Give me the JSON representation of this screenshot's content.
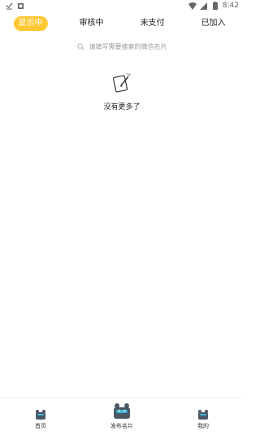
{
  "status_bar": {
    "time": "8:42",
    "icons": [
      "download-icon",
      "notification-icon",
      "wifi-icon",
      "signal-icon",
      "battery-icon"
    ]
  },
  "tabs": [
    {
      "label": "显示中",
      "active": true
    },
    {
      "label": "审核中",
      "active": false
    },
    {
      "label": "未支付",
      "active": false
    },
    {
      "label": "已加入",
      "active": false
    }
  ],
  "search": {
    "placeholder": "请填写需要搜索的微信名片"
  },
  "empty_state": {
    "message": "没有更多了"
  },
  "bottom_nav": {
    "items": [
      {
        "label": "首页",
        "icon": "home-icon"
      },
      {
        "label": "发布名片",
        "icon": "publish-card-icon"
      },
      {
        "label": "我的",
        "icon": "profile-icon"
      }
    ]
  },
  "colors": {
    "accent": "#FFC832",
    "icon_dark": "#4a5866",
    "icon_teal": "#3fb7d6"
  }
}
